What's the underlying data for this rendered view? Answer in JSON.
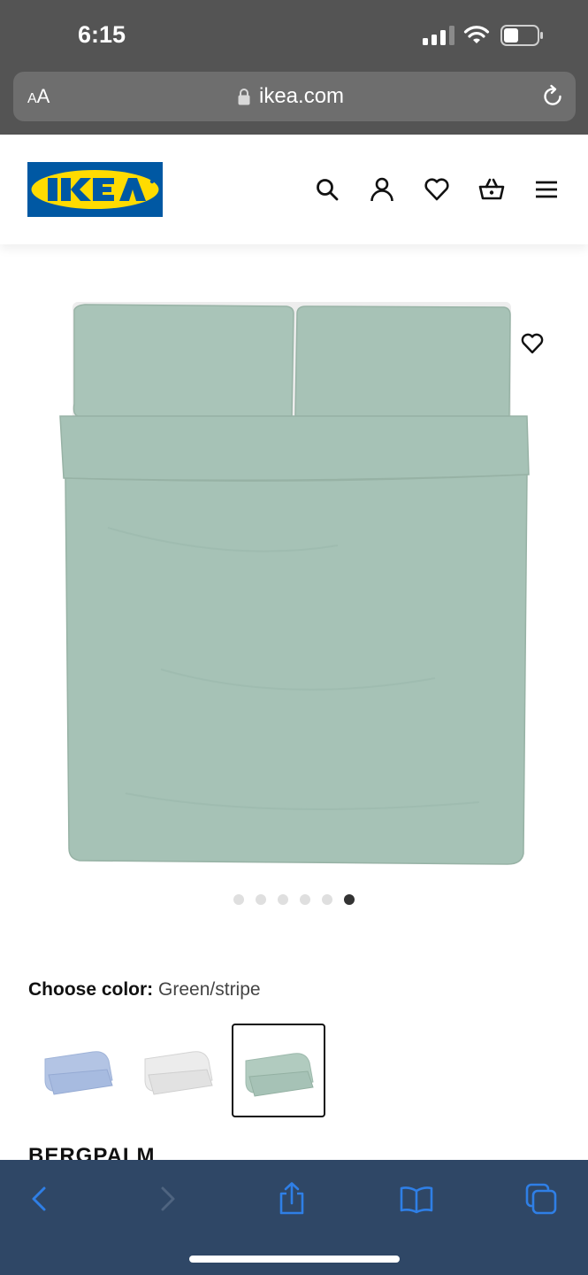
{
  "status_bar": {
    "time": "6:15"
  },
  "browser": {
    "text_size_label_small": "A",
    "text_size_label_large": "A",
    "url": "ikea.com"
  },
  "site": {
    "logo_text": "IKEA",
    "nav_icons": [
      "search-icon",
      "account-icon",
      "heart-icon",
      "basket-icon",
      "menu-icon"
    ]
  },
  "product": {
    "image_count": 6,
    "active_image_index": 6,
    "choose_color_label": "Choose color:",
    "selected_color": "Green/stripe",
    "color_options": [
      "light-blue",
      "white",
      "green"
    ],
    "name_partial": "BERGPALM"
  },
  "colors": {
    "ikea_blue": "#0058a3",
    "ikea_yellow": "#ffdb00",
    "bed_green": "#a6c2b6",
    "toolbar_icon_blue": "#2f7fe6"
  },
  "toolbar": {
    "icons": [
      "back-icon",
      "forward-icon",
      "share-icon",
      "bookmarks-icon",
      "tabs-icon"
    ]
  }
}
